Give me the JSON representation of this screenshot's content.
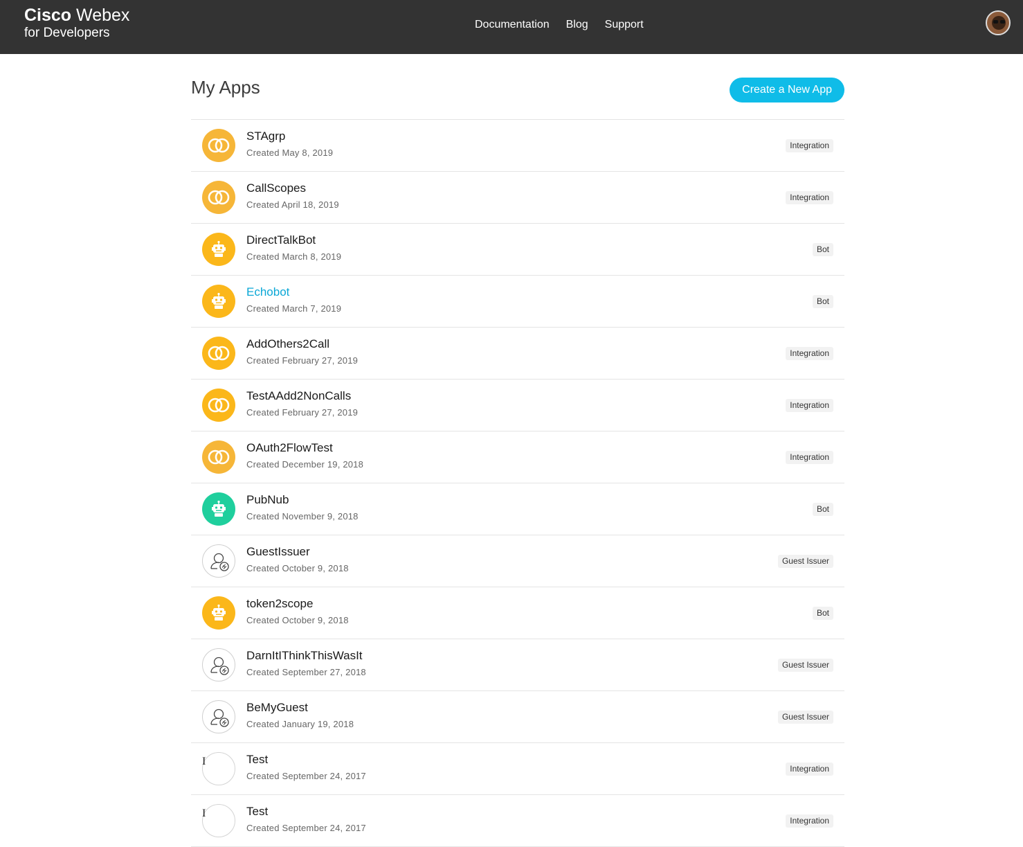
{
  "header": {
    "brand_bold": "Cisco",
    "brand_light": "Webex",
    "brand_sub": "for Developers",
    "nav": [
      "Documentation",
      "Blog",
      "Support"
    ]
  },
  "page": {
    "title": "My Apps",
    "create_button": "Create a New App"
  },
  "apps": [
    {
      "name": "STAgrp",
      "date": "Created May 8, 2019",
      "type": "Integration",
      "icon": "integration-rings-icon"
    },
    {
      "name": "CallScopes",
      "date": "Created April 18, 2019",
      "type": "Integration",
      "icon": "integration-rings-icon"
    },
    {
      "name": "DirectTalkBot",
      "date": "Created March 8, 2019",
      "type": "Bot",
      "icon": "bot-icon"
    },
    {
      "name": "Echobot",
      "date": "Created March 7, 2019",
      "type": "Bot",
      "icon": "bot-icon"
    },
    {
      "name": "AddOthers2Call",
      "date": "Created February 27, 2019",
      "type": "Integration",
      "icon": "integration-rings-icon"
    },
    {
      "name": "TestAAdd2NonCalls",
      "date": "Created February 27, 2019",
      "type": "Integration",
      "icon": "integration-rings-icon"
    },
    {
      "name": "OAuth2FlowTest",
      "date": "Created December 19, 2018",
      "type": "Integration",
      "icon": "integration-rings-icon"
    },
    {
      "name": "PubNub",
      "date": "Created November 9, 2018",
      "type": "Bot",
      "icon": "bot-icon"
    },
    {
      "name": "GuestIssuer",
      "date": "Created October 9, 2018",
      "type": "Guest Issuer",
      "icon": "guest-user-icon"
    },
    {
      "name": "token2scope",
      "date": "Created October 9, 2018",
      "type": "Bot",
      "icon": "bot-icon"
    },
    {
      "name": "DarnItIThinkThisWasIt",
      "date": "Created September 27, 2018",
      "type": "Guest Issuer",
      "icon": "guest-user-icon"
    },
    {
      "name": "BeMyGuest",
      "date": "Created January 19, 2018",
      "type": "Guest Issuer",
      "icon": "guest-user-icon"
    },
    {
      "name": "Test",
      "date": "Created September 24, 2017",
      "type": "Integration",
      "icon": "broken-image-icon",
      "icon_text": "I"
    },
    {
      "name": "Test",
      "date": "Created September 24, 2017",
      "type": "Integration",
      "icon": "broken-image-icon",
      "icon_text": "I"
    }
  ],
  "colors": {
    "topbar": "#333333",
    "accent": "#0fbce8",
    "link": "#0aa7d6",
    "integration": "#f6b638",
    "bot": "#fbb71a",
    "bot_green": "#1fcf9d"
  }
}
